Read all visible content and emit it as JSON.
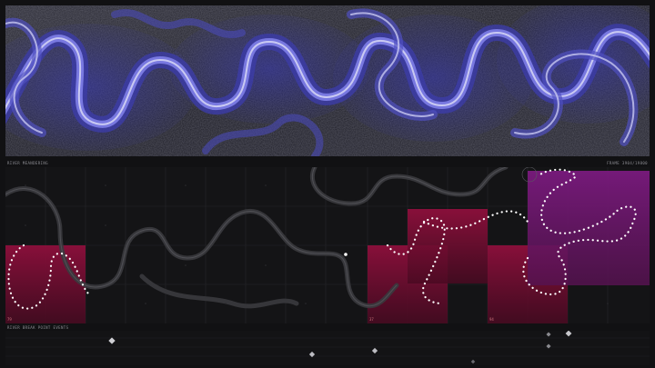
{
  "header": {
    "left_label": "RIVER MEANDERING",
    "right_label": "FRAME 3904/19800"
  },
  "grid": {
    "tiles": [
      {
        "label": "79",
        "highlight": "crimson"
      },
      {
        "label": "37",
        "highlight": "crimson"
      },
      {
        "label": "",
        "highlight": "crimson"
      },
      {
        "label": "94",
        "highlight": "crimson"
      },
      {
        "label": "",
        "highlight": "magenta"
      }
    ],
    "marker_icon": "dot-marker-icon"
  },
  "timeline": {
    "label": "RIVER BREAK POINT EVENTS",
    "event_icon": "diamond-event-icon"
  },
  "colors": {
    "background": "#111113",
    "river": "#5a5ad8",
    "crimson_tile": "#a01040",
    "magenta_tile": "#8a1a8a",
    "path_dots": "#ffffff"
  }
}
